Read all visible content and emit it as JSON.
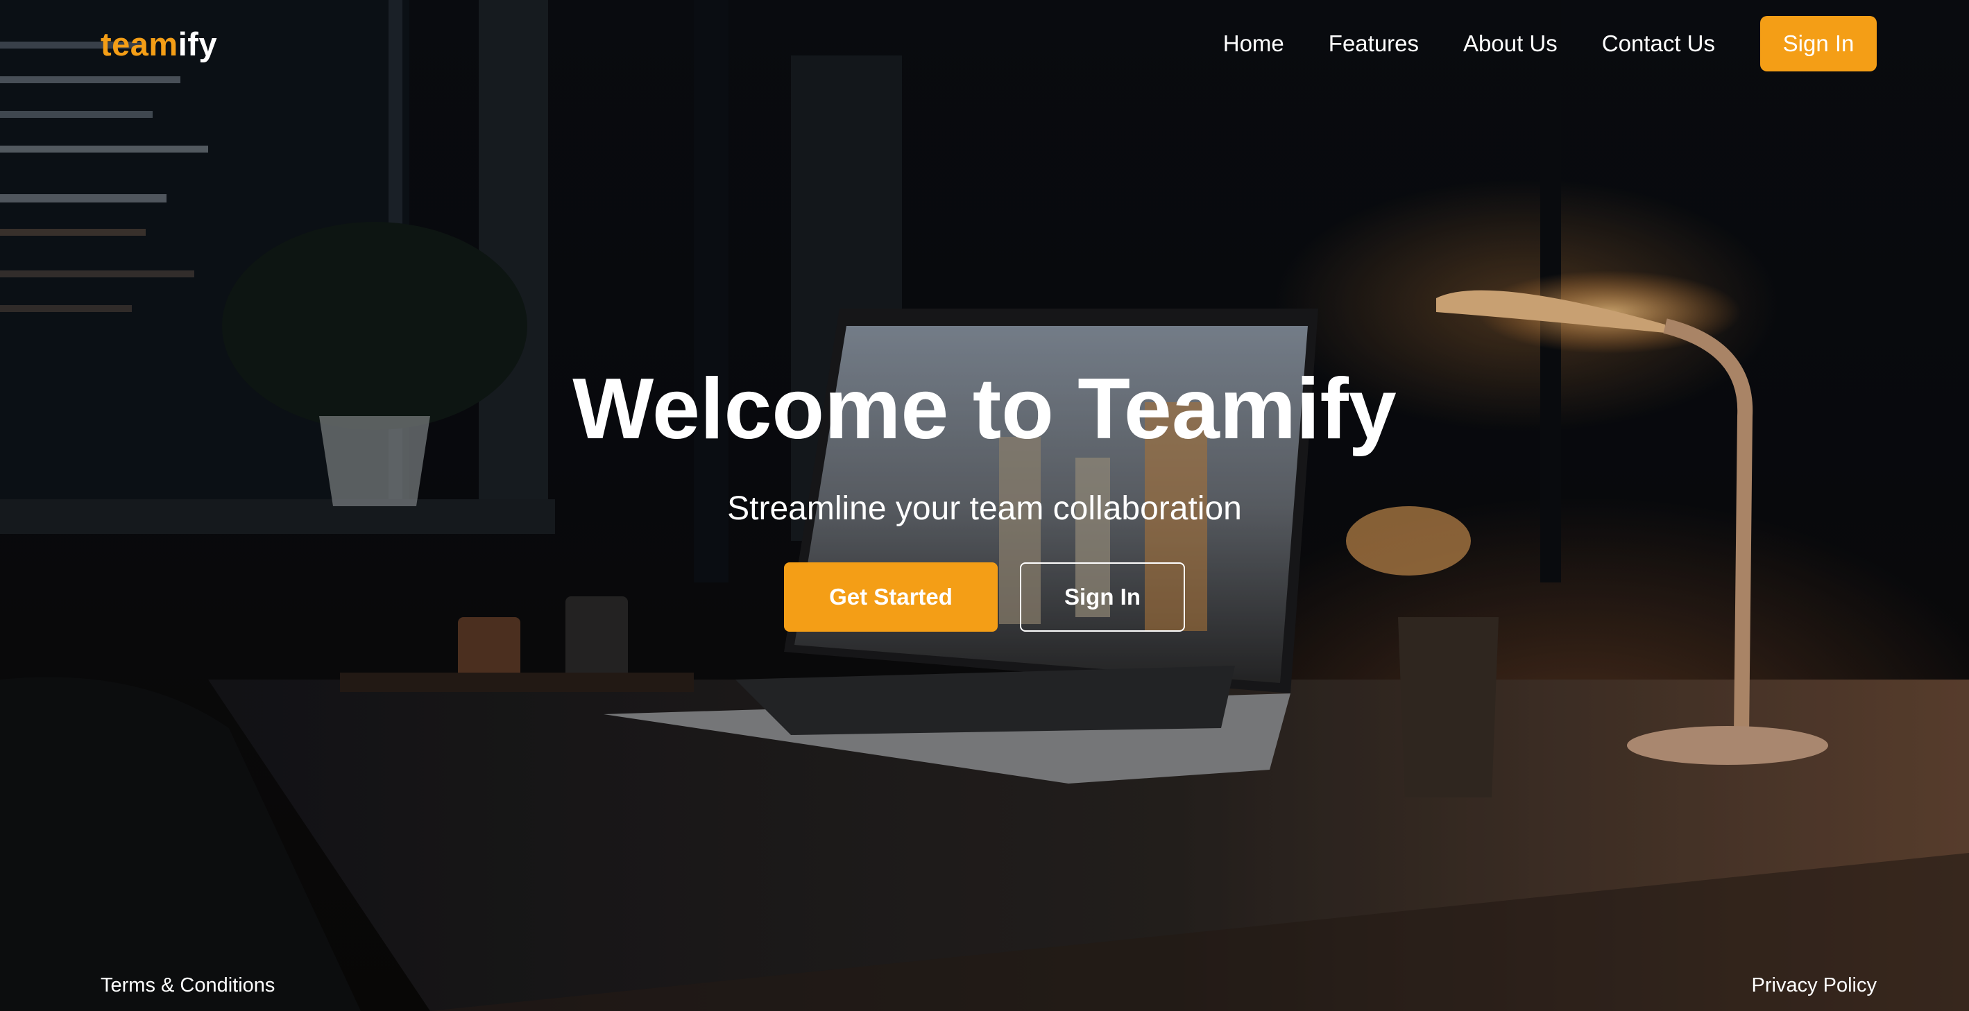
{
  "header": {
    "logo_accent": "team",
    "logo_rest": "ify",
    "nav": [
      {
        "label": "Home"
      },
      {
        "label": "Features"
      },
      {
        "label": "About Us"
      },
      {
        "label": "Contact Us"
      }
    ],
    "signin_label": "Sign In"
  },
  "hero": {
    "title": "Welcome to Teamify",
    "subtitle": "Streamline your team collaboration",
    "primary_cta": "Get Started",
    "secondary_cta": "Sign In",
    "background_image": "dark-desk-laptop-lamp-photo"
  },
  "footer": {
    "left_link": "Terms & Conditions",
    "right_link": "Privacy Policy"
  },
  "colors": {
    "accent": "#f49e16",
    "text": "#ffffff",
    "background": "#07080b"
  }
}
